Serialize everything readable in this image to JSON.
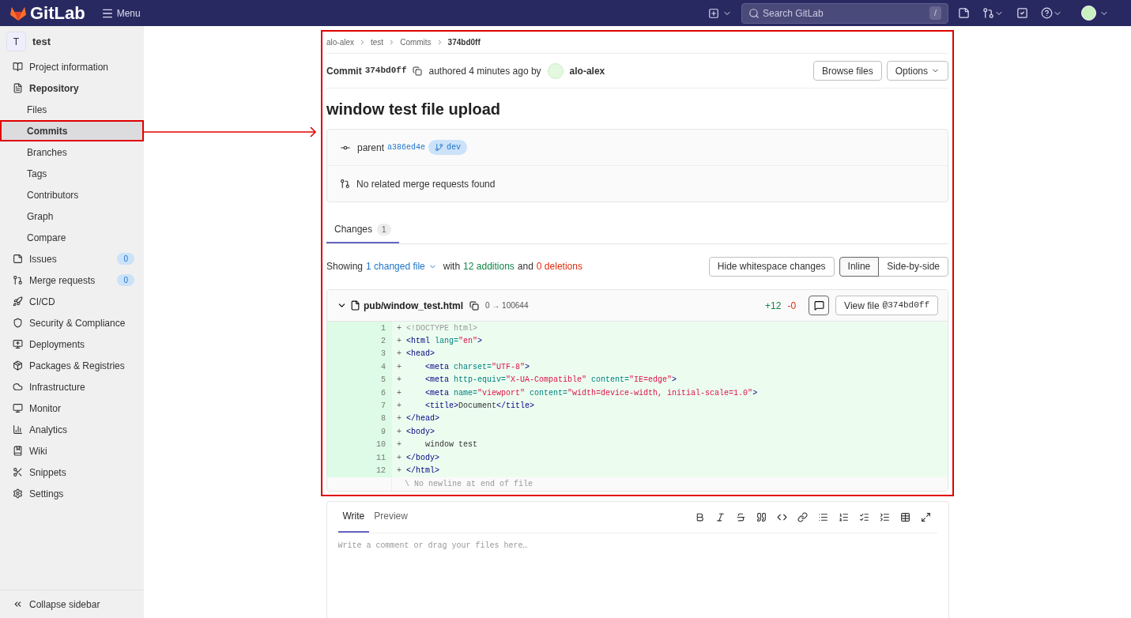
{
  "top_bar": {
    "logo_text": "GitLab",
    "menu_label": "Menu",
    "search_placeholder": "Search GitLab",
    "search_shortcut": "/"
  },
  "sidebar": {
    "project_initial": "T",
    "project_name": "test",
    "items": [
      {
        "label": "Project information",
        "kind": "section",
        "selected": false
      },
      {
        "label": "Repository",
        "kind": "section",
        "selected": false
      },
      {
        "label": "Files",
        "kind": "sub",
        "selected": false
      },
      {
        "label": "Commits",
        "kind": "sub",
        "selected": true
      },
      {
        "label": "Branches",
        "kind": "sub",
        "selected": false
      },
      {
        "label": "Tags",
        "kind": "sub",
        "selected": false
      },
      {
        "label": "Contributors",
        "kind": "sub",
        "selected": false
      },
      {
        "label": "Graph",
        "kind": "sub",
        "selected": false
      },
      {
        "label": "Compare",
        "kind": "sub",
        "selected": false
      },
      {
        "label": "Issues",
        "kind": "section",
        "selected": false,
        "badge": "0"
      },
      {
        "label": "Merge requests",
        "kind": "section",
        "selected": false,
        "badge": "0"
      },
      {
        "label": "CI/CD",
        "kind": "section",
        "selected": false
      },
      {
        "label": "Security & Compliance",
        "kind": "section",
        "selected": false
      },
      {
        "label": "Deployments",
        "kind": "section",
        "selected": false
      },
      {
        "label": "Packages & Registries",
        "kind": "section",
        "selected": false
      },
      {
        "label": "Infrastructure",
        "kind": "section",
        "selected": false
      },
      {
        "label": "Monitor",
        "kind": "section",
        "selected": false
      },
      {
        "label": "Analytics",
        "kind": "section",
        "selected": false
      },
      {
        "label": "Wiki",
        "kind": "section",
        "selected": false
      },
      {
        "label": "Snippets",
        "kind": "section",
        "selected": false
      },
      {
        "label": "Settings",
        "kind": "section",
        "selected": false
      }
    ],
    "collapse_label": "Collapse sidebar"
  },
  "breadcrumbs": [
    "alo-alex",
    "test",
    "Commits",
    "374bd0ff"
  ],
  "commit_header": {
    "label": "Commit",
    "sha": "374bd0ff",
    "authored": "authored 4 minutes ago by",
    "author": "alo-alex",
    "browse_button": "Browse files",
    "options_button": "Options"
  },
  "title": "window test file upload",
  "info": {
    "parent_label": "parent",
    "parent_sha": "a386ed4e",
    "branch": "dev",
    "merge_requests_text": "No related merge requests found"
  },
  "tabs": [
    {
      "label": "Changes",
      "count": "1",
      "selected": true
    }
  ],
  "diff_summary": {
    "showing": "Showing",
    "changed": "1 changed file",
    "with": "with",
    "additions": "12 additions",
    "and": "and",
    "deletions": "0 deletions"
  },
  "view_buttons": {
    "hide_whitespace": "Hide whitespace changes",
    "modes": [
      {
        "label": "Inline",
        "selected": true
      },
      {
        "label": "Side-by-side",
        "selected": false
      }
    ]
  },
  "file": {
    "path": "pub/window_test.html",
    "mode": "0 → 100644",
    "added": "+12",
    "removed": "-0",
    "view_button": "View file @374bd0ff",
    "lines": [
      {
        "number": "1",
        "sign": "+",
        "indented": false,
        "tokens": [
          {
            "kind": "doctype",
            "text": "<!DOCTYPE html>"
          }
        ]
      },
      {
        "number": "2",
        "sign": "+",
        "indented": false,
        "tokens": [
          {
            "kind": "tag",
            "text": "<html "
          },
          {
            "kind": "attr",
            "text": "lang="
          },
          {
            "kind": "string",
            "text": "\"en\""
          },
          {
            "kind": "tag",
            "text": ">"
          }
        ]
      },
      {
        "number": "3",
        "sign": "+",
        "indented": false,
        "tokens": [
          {
            "kind": "tag",
            "text": "<head>"
          }
        ]
      },
      {
        "number": "4",
        "sign": "+",
        "indented": true,
        "tokens": [
          {
            "kind": "tag",
            "text": "<meta "
          },
          {
            "kind": "attr",
            "text": "charset="
          },
          {
            "kind": "string",
            "text": "\"UTF-8\""
          },
          {
            "kind": "tag",
            "text": ">"
          }
        ]
      },
      {
        "number": "5",
        "sign": "+",
        "indented": true,
        "tokens": [
          {
            "kind": "tag",
            "text": "<meta "
          },
          {
            "kind": "attr",
            "text": "http-equiv="
          },
          {
            "kind": "string",
            "text": "\"X-UA-Compatible\""
          },
          {
            "kind": "attr",
            "text": " content="
          },
          {
            "kind": "string",
            "text": "\"IE=edge\""
          },
          {
            "kind": "tag",
            "text": ">"
          }
        ]
      },
      {
        "number": "6",
        "sign": "+",
        "indented": true,
        "tokens": [
          {
            "kind": "tag",
            "text": "<meta "
          },
          {
            "kind": "attr",
            "text": "name="
          },
          {
            "kind": "string",
            "text": "\"viewport\""
          },
          {
            "kind": "attr",
            "text": " content="
          },
          {
            "kind": "string",
            "text": "\"width=device-width, initial-scale=1.0\""
          },
          {
            "kind": "tag",
            "text": ">"
          }
        ]
      },
      {
        "number": "7",
        "sign": "+",
        "indented": true,
        "tokens": [
          {
            "kind": "tag",
            "text": "<title>"
          },
          {
            "kind": "plain",
            "text": "Document"
          },
          {
            "kind": "tag",
            "text": "</title>"
          }
        ]
      },
      {
        "number": "8",
        "sign": "+",
        "indented": false,
        "tokens": [
          {
            "kind": "tag",
            "text": "</head>"
          }
        ]
      },
      {
        "number": "9",
        "sign": "+",
        "indented": false,
        "tokens": [
          {
            "kind": "tag",
            "text": "<body>"
          }
        ]
      },
      {
        "number": "10",
        "sign": "+",
        "indented": true,
        "tokens": [
          {
            "kind": "plain",
            "text": "window test"
          }
        ]
      },
      {
        "number": "11",
        "sign": "+",
        "indented": false,
        "tokens": [
          {
            "kind": "tag",
            "text": "</body>"
          }
        ]
      },
      {
        "number": "12",
        "sign": "+",
        "indented": false,
        "tokens": [
          {
            "kind": "tag",
            "text": "</html>"
          }
        ]
      }
    ],
    "note": "\\ No newline at end of file"
  },
  "comment": {
    "tabs": [
      {
        "label": "Write",
        "selected": true
      },
      {
        "label": "Preview",
        "selected": false
      }
    ],
    "placeholder": "Write a comment or drag your files here…"
  }
}
